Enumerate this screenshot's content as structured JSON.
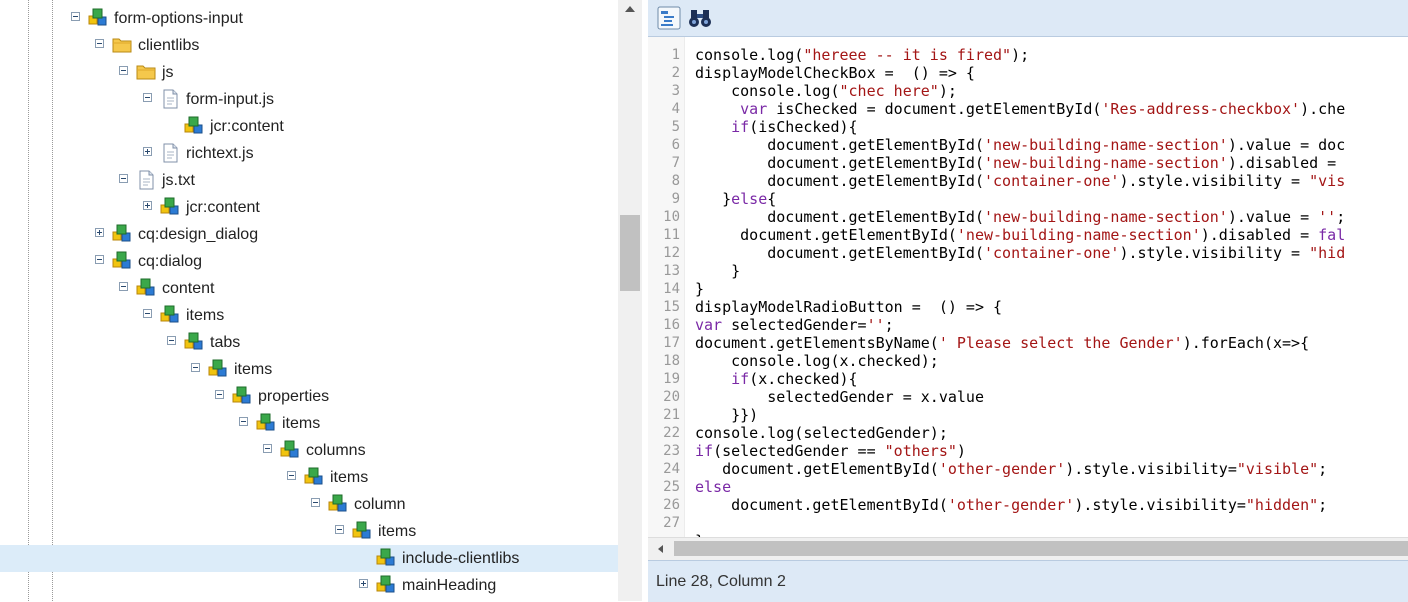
{
  "tree": {
    "rows": [
      {
        "label": "form-options-input",
        "toggle": "minus",
        "icon": "node"
      },
      {
        "label": "clientlibs",
        "toggle": "minus",
        "icon": "folder"
      },
      {
        "label": "js",
        "toggle": "minus",
        "icon": "folder"
      },
      {
        "label": "form-input.js",
        "toggle": "minus",
        "icon": "file"
      },
      {
        "label": "jcr:content",
        "toggle": "none",
        "icon": "node"
      },
      {
        "label": "richtext.js",
        "toggle": "plus",
        "icon": "file"
      },
      {
        "label": "js.txt",
        "toggle": "minus",
        "icon": "file"
      },
      {
        "label": "jcr:content",
        "toggle": "plus",
        "icon": "node"
      },
      {
        "label": "cq:design_dialog",
        "toggle": "plus",
        "icon": "node"
      },
      {
        "label": "cq:dialog",
        "toggle": "minus",
        "icon": "node"
      },
      {
        "label": "content",
        "toggle": "minus",
        "icon": "node"
      },
      {
        "label": "items",
        "toggle": "minus",
        "icon": "node"
      },
      {
        "label": "tabs",
        "toggle": "minus",
        "icon": "node"
      },
      {
        "label": "items",
        "toggle": "minus",
        "icon": "node"
      },
      {
        "label": "properties",
        "toggle": "minus",
        "icon": "node"
      },
      {
        "label": "items",
        "toggle": "minus",
        "icon": "node"
      },
      {
        "label": "columns",
        "toggle": "minus",
        "icon": "node"
      },
      {
        "label": "items",
        "toggle": "minus",
        "icon": "node"
      },
      {
        "label": "column",
        "toggle": "minus",
        "icon": "node"
      },
      {
        "label": "items",
        "toggle": "minus",
        "icon": "node"
      },
      {
        "label": "include-clientlibs",
        "toggle": "none",
        "icon": "node",
        "selected": true
      },
      {
        "label": "mainHeading",
        "toggle": "plus",
        "icon": "node"
      }
    ]
  },
  "editor": {
    "toolbar": {
      "format_button": "format-code-icon",
      "find_button": "binoculars-icon"
    },
    "code_lines": [
      [
        [
          "console.log(",
          ""
        ],
        [
          "\"hereee -- it is fired\"",
          "str"
        ],
        [
          ");",
          ""
        ]
      ],
      [
        [
          "displayModelCheckBox =  () => {",
          ""
        ]
      ],
      [
        [
          "    console.log(",
          ""
        ],
        [
          "\"chec here\"",
          "str"
        ],
        [
          ");",
          ""
        ]
      ],
      [
        [
          "     ",
          ""
        ],
        [
          "var",
          "kw"
        ],
        [
          " isChecked = document.getElementById(",
          ""
        ],
        [
          "'Res-address-checkbox'",
          "str"
        ],
        [
          ").che",
          ""
        ]
      ],
      [
        [
          "    ",
          ""
        ],
        [
          "if",
          "kw"
        ],
        [
          "(isChecked){",
          ""
        ]
      ],
      [
        [
          "        document.getElementById(",
          ""
        ],
        [
          "'new-building-name-section'",
          "str"
        ],
        [
          ").value = doc",
          ""
        ]
      ],
      [
        [
          "        document.getElementById(",
          ""
        ],
        [
          "'new-building-name-section'",
          "str"
        ],
        [
          ").disabled = ",
          ""
        ]
      ],
      [
        [
          "        document.getElementById(",
          ""
        ],
        [
          "'container-one'",
          "str"
        ],
        [
          ").style.visibility = ",
          ""
        ],
        [
          "\"vis",
          "str"
        ]
      ],
      [
        [
          "   }",
          ""
        ],
        [
          "else",
          "kw"
        ],
        [
          "{",
          ""
        ]
      ],
      [
        [
          "        document.getElementById(",
          ""
        ],
        [
          "'new-building-name-section'",
          "str"
        ],
        [
          ").value = ",
          ""
        ],
        [
          "''",
          "str"
        ],
        [
          ";",
          ""
        ]
      ],
      [
        [
          "     document.getElementById(",
          ""
        ],
        [
          "'new-building-name-section'",
          "str"
        ],
        [
          ").disabled = ",
          ""
        ],
        [
          "fal",
          "kw"
        ]
      ],
      [
        [
          "        document.getElementById(",
          ""
        ],
        [
          "'container-one'",
          "str"
        ],
        [
          ").style.visibility = ",
          ""
        ],
        [
          "\"hid",
          "str"
        ]
      ],
      [
        [
          "    }",
          ""
        ]
      ],
      [
        [
          "}",
          ""
        ]
      ],
      [
        [
          "displayModelRadioButton =  () => {",
          ""
        ]
      ],
      [
        [
          "",
          ""
        ],
        [
          "var",
          "kw"
        ],
        [
          " selectedGender=",
          ""
        ],
        [
          "''",
          "str"
        ],
        [
          ";",
          ""
        ]
      ],
      [
        [
          "document.getElementsByName(",
          ""
        ],
        [
          "' Please select the Gender'",
          "str"
        ],
        [
          ").forEach(x=>{",
          ""
        ]
      ],
      [
        [
          "    console.log(x.checked);",
          ""
        ]
      ],
      [
        [
          "    ",
          ""
        ],
        [
          "if",
          "kw"
        ],
        [
          "(x.checked){",
          ""
        ]
      ],
      [
        [
          "        selectedGender = x.value",
          ""
        ]
      ],
      [
        [
          "    }})",
          ""
        ]
      ],
      [
        [
          "console.log(selectedGender);",
          ""
        ]
      ],
      [
        [
          "",
          ""
        ],
        [
          "if",
          "kw"
        ],
        [
          "(selectedGender == ",
          ""
        ],
        [
          "\"others\"",
          "str"
        ],
        [
          ")",
          ""
        ]
      ],
      [
        [
          "   document.getElementById(",
          ""
        ],
        [
          "'other-gender'",
          "str"
        ],
        [
          ").style.visibility=",
          ""
        ],
        [
          "\"visible\"",
          "str"
        ],
        [
          ";",
          ""
        ]
      ],
      [
        [
          "",
          ""
        ],
        [
          "else",
          "kw"
        ]
      ],
      [
        [
          "    document.getElementById(",
          ""
        ],
        [
          "'other-gender'",
          "str"
        ],
        [
          ").style.visibility=",
          ""
        ],
        [
          "\"hidden\"",
          "str"
        ],
        [
          ";",
          ""
        ]
      ],
      [
        [
          "",
          ""
        ]
      ],
      [
        [
          "}",
          ""
        ]
      ]
    ],
    "line_numbers": [
      "1",
      "2",
      "3",
      "4",
      "5",
      "6",
      "7",
      "8",
      "9",
      "10",
      "11",
      "12",
      "13",
      "14",
      "15",
      "16",
      "17",
      "18",
      "19",
      "20",
      "21",
      "22",
      "23",
      "24",
      "25",
      "26",
      "27"
    ],
    "status": "Line 28, Column 2"
  },
  "colors": {
    "keyword": "#7a29a6",
    "string": "#a31515",
    "selection": "#dcecf9",
    "toolbar_bg": "#dde9f6"
  }
}
